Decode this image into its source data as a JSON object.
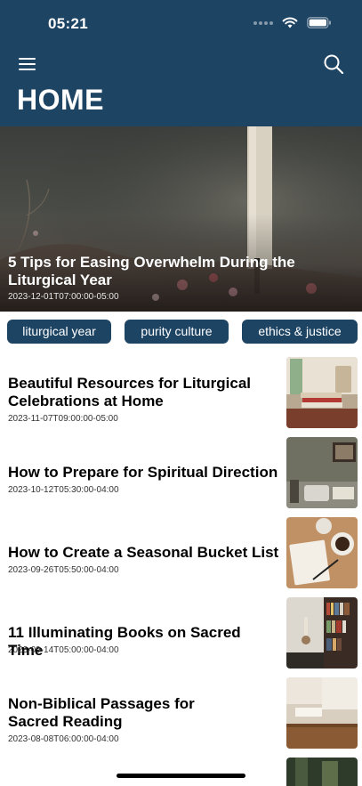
{
  "status_bar": {
    "time": "05:21"
  },
  "header": {
    "title": "HOME",
    "menu_icon": "hamburger-menu-icon",
    "search_icon": "search-icon",
    "background": "#1e4464"
  },
  "featured": {
    "title": "5 Tips for Easing Overwhelm During the Liturgical Year",
    "date": "2023-12-01T07:00:00-05:00"
  },
  "tags": [
    "liturgical year",
    "purity culture",
    "ethics & justice"
  ],
  "articles": [
    {
      "title": "Beautiful Resources for Liturgical Celebrations at Home",
      "date": "2023-11-07T09:00:00-05:00"
    },
    {
      "title": "How to Prepare for Spiritual Direction",
      "date": "2023-10-12T05:30:00-04:00"
    },
    {
      "title": "How to Create a Seasonal Bucket List",
      "date": "2023-09-26T05:50:00-04:00"
    },
    {
      "title": "11 Illuminating Books on Sacred Time",
      "date": "2023-09-14T05:00:00-04:00"
    },
    {
      "title": "Non-Biblical Passages for Sacred Reading",
      "date": "2023-08-08T06:00:00-04:00"
    }
  ]
}
